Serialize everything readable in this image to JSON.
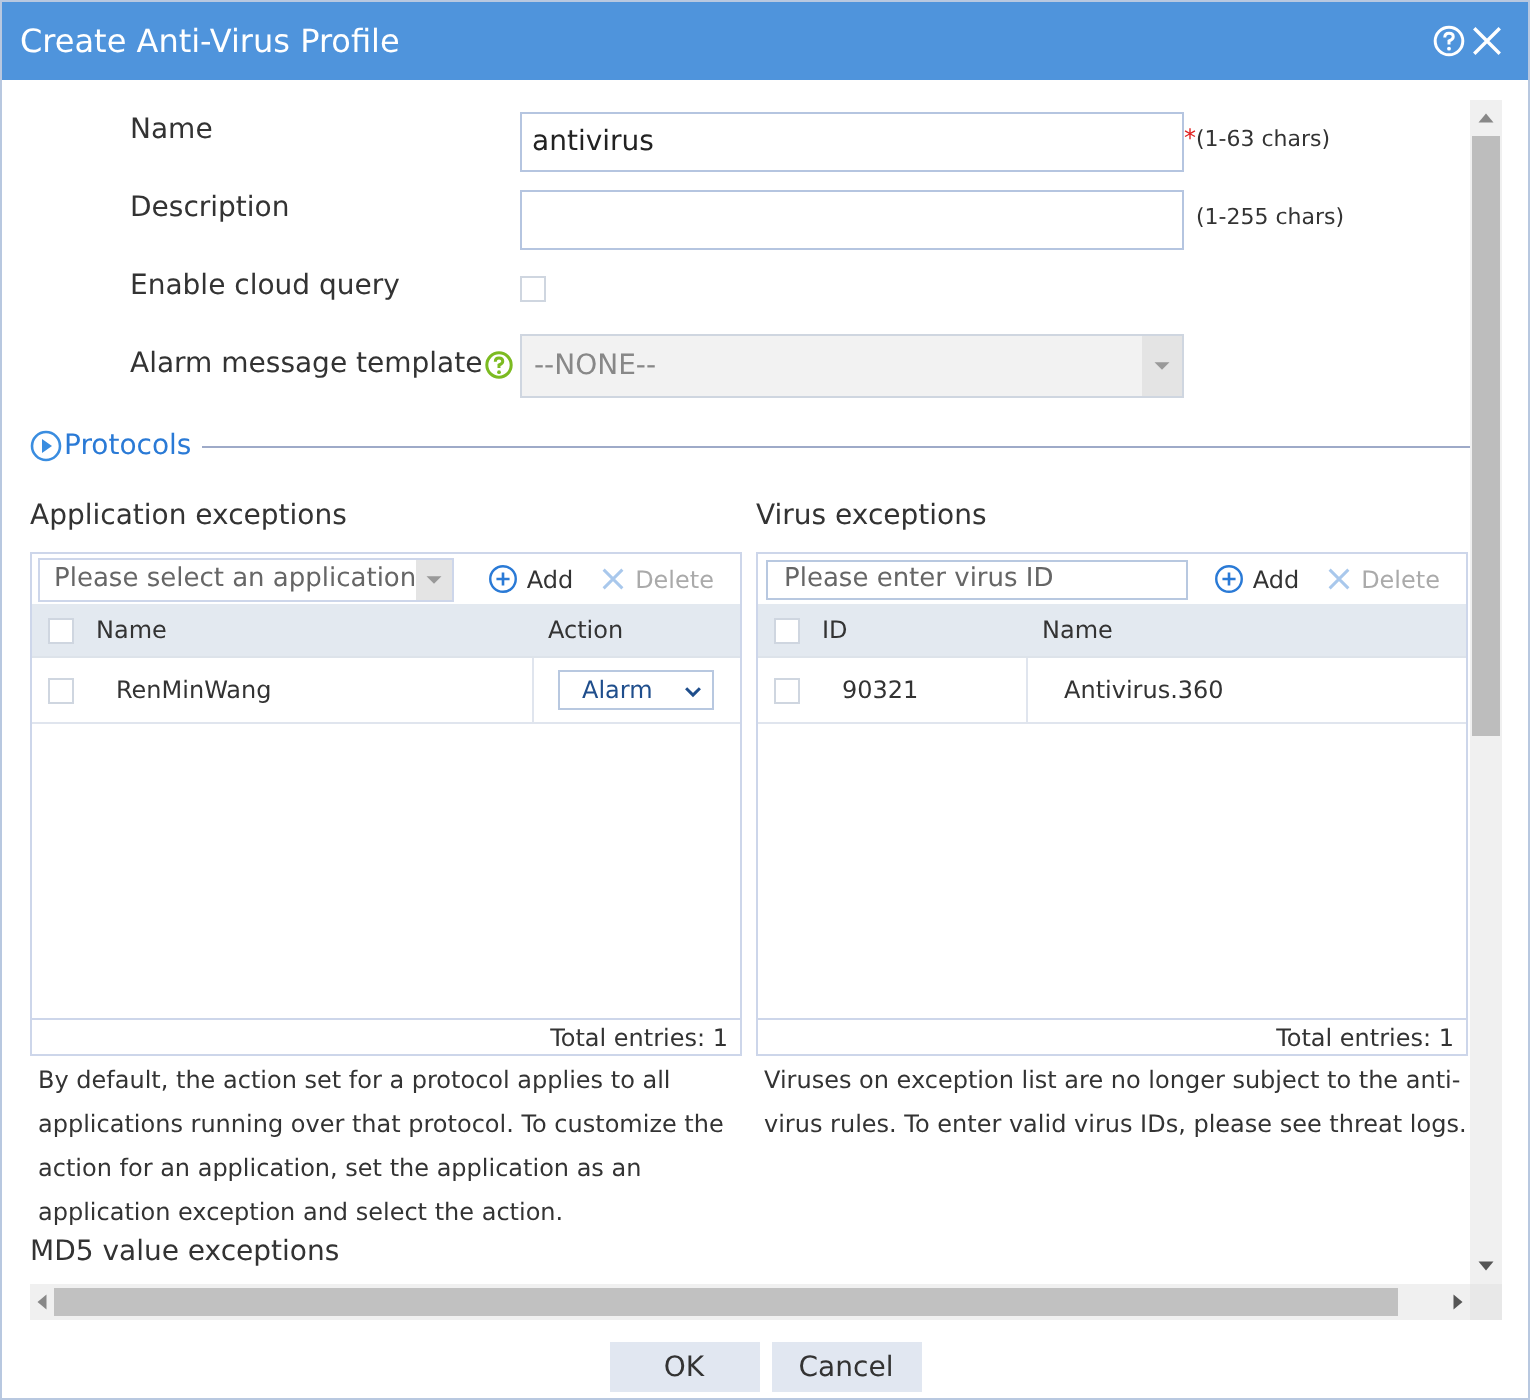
{
  "window": {
    "title": "Create Anti-Virus Profile"
  },
  "form": [
    {
      "kind": "text",
      "label": "Name",
      "value": "antivirus",
      "mark": "*",
      "hint": "(1-63 chars)"
    },
    {
      "kind": "text",
      "label": "Description",
      "hint": "(1-255 chars)"
    },
    {
      "kind": "checkbox",
      "label": "Enable cloud query",
      "checked": false
    },
    {
      "kind": "select",
      "label": "Alarm message template",
      "help": true,
      "value": "--NONE--",
      "disabled": true
    }
  ],
  "protocols": {
    "label": "Protocols",
    "expanded": false
  },
  "panels": [
    {
      "title": "Application exceptions",
      "input": {
        "kind": "select",
        "placeholder": "Please select an application"
      },
      "add": "Add",
      "delete": {
        "label": "Delete",
        "disabled": true
      },
      "all_checked": false,
      "columns": [
        "Name",
        "Action"
      ],
      "rows": [
        {
          "checked": false,
          "cells": [
            {
              "kind": "text",
              "text": "RenMinWang"
            },
            {
              "kind": "select",
              "text": "Alarm"
            }
          ]
        }
      ],
      "total": "Total entries: 1",
      "note": "By default, the action set for a protocol applies to all applications running over that protocol. To customize the action for an application, set the application as an application exception and select the action."
    },
    {
      "title": "Virus exceptions",
      "input": {
        "kind": "text",
        "placeholder": "Please enter virus ID"
      },
      "add": "Add",
      "delete": {
        "label": "Delete",
        "disabled": true
      },
      "all_checked": false,
      "columns": [
        "ID",
        "Name"
      ],
      "rows": [
        {
          "checked": false,
          "cells": [
            {
              "kind": "text",
              "text": "90321"
            },
            {
              "kind": "text",
              "text": "Antivirus.360"
            }
          ]
        }
      ],
      "total": "Total entries: 1",
      "note": "Viruses on exception list are no longer subject to the anti-virus rules. To enter valid virus IDs, please see threat logs."
    }
  ],
  "md5": {
    "title": "MD5 value exceptions"
  },
  "buttons": [
    "OK",
    "Cancel"
  ]
}
